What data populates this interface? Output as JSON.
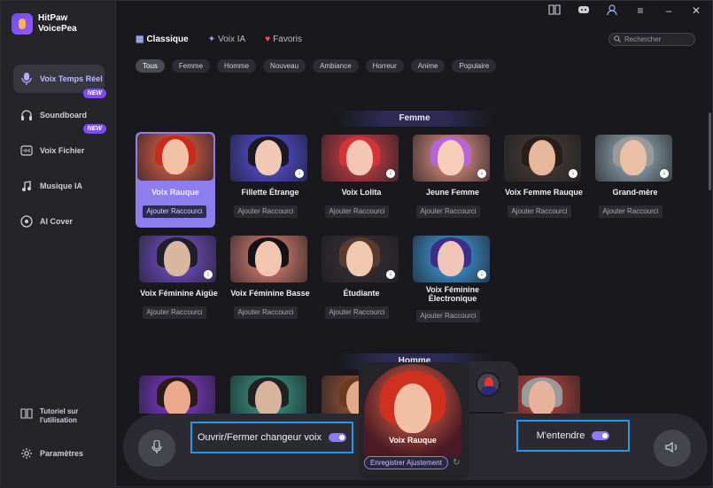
{
  "app": {
    "brand_line1": "HitPaw",
    "brand_line2": "VoicePea"
  },
  "sidebar": {
    "items": [
      {
        "label": "Voix Temps Réel",
        "icon": "microphone-icon",
        "active": true
      },
      {
        "label": "Soundboard",
        "icon": "headphones-icon",
        "badge": "NEW"
      },
      {
        "label": "Voix Fichier",
        "icon": "file-audio-icon",
        "badge": "NEW"
      },
      {
        "label": "Musique IA",
        "icon": "music-note-icon"
      },
      {
        "label": "AI Cover",
        "icon": "disc-icon"
      }
    ],
    "tutorial_label": "Tutoriel sur l'utilisation",
    "settings_label": "Paramètres"
  },
  "tabs": [
    {
      "label": "Classique",
      "icon": "grid-icon",
      "active": true
    },
    {
      "label": "Voix IA",
      "icon": "sparkle-icon"
    },
    {
      "label": "Favoris",
      "icon": "heart-icon"
    }
  ],
  "search": {
    "placeholder": "Rechercher"
  },
  "filters": [
    "Tous",
    "Femme",
    "Homme",
    "Nouveau",
    "Ambiance",
    "Horreur",
    "Anime",
    "Populaire"
  ],
  "sections": {
    "female": "Femme",
    "male": "Homme"
  },
  "voice_button_label": "Ajouter Raccourci",
  "female_voices": [
    {
      "name": "Voix Rauque",
      "selected": true,
      "bg": "#f36a4c",
      "hair": "#c92a1b",
      "skin": "#f3c2a6"
    },
    {
      "name": "Fillette Étrange",
      "bg": "#5b56f0",
      "hair": "#1a1a22",
      "skin": "#f2c9b5",
      "download": true
    },
    {
      "name": "Voix Lolita",
      "bg": "#d9434a",
      "hair": "#d6323a",
      "skin": "#f4c6b4",
      "download": true
    },
    {
      "name": "Jeune Femme",
      "bg": "#ef9a8a",
      "hair": "#b764d6",
      "skin": "#f6cdb9",
      "download": true
    },
    {
      "name": "Voix Femme Rauque",
      "bg": "#4c4038",
      "hair": "#2a1e18",
      "skin": "#e7b79b",
      "download": true
    },
    {
      "name": "Grand-mère",
      "bg": "#9fb9c6",
      "hair": "#9a9a9a",
      "skin": "#e9c0a6",
      "download": true
    },
    {
      "name": "Voix Féminine Aigüe",
      "bg": "#7e55d9",
      "hair": "#20202a",
      "skin": "#d9b69f",
      "download": true
    },
    {
      "name": "Voix Féminine Basse",
      "bg": "#ef8a7a",
      "hair": "#141418",
      "skin": "#f2c5b0",
      "download": false
    },
    {
      "name": "Étudiante",
      "bg": "#3a3236",
      "hair": "#5a3a2a",
      "skin": "#f1c8b0",
      "download": true
    },
    {
      "name": "Voix Féminine Électronique",
      "bg": "#42a8f0",
      "hair": "#3b2f8a",
      "skin": "#f0c4b6",
      "download": true
    }
  ],
  "male_voices_partial": [
    {
      "bg": "#8a3ee0",
      "hair": "#2a1c16",
      "skin": "#e9a98a"
    },
    {
      "bg": "#3aa58f",
      "hair": "#222226",
      "skin": "#d9b49c"
    },
    {
      "bg": "#a85a3c",
      "hair": "#6a3a22",
      "skin": "#e2a88a"
    },
    {
      "bg": "#c24a45",
      "hair": "#9a9a9a",
      "skin": "#e6b29b"
    }
  ],
  "bottom": {
    "toggle_voice_label": "Ouvrir/Fermer changeur voix",
    "toggle_voice_on": true,
    "listen_label": "M'entendre",
    "listen_on": true,
    "current_voice": "Voix Rauque",
    "record_button": "Enregistrer Ajustement"
  },
  "colors": {
    "accent": "#8e7dec",
    "highlight_border": "#2196f3"
  }
}
